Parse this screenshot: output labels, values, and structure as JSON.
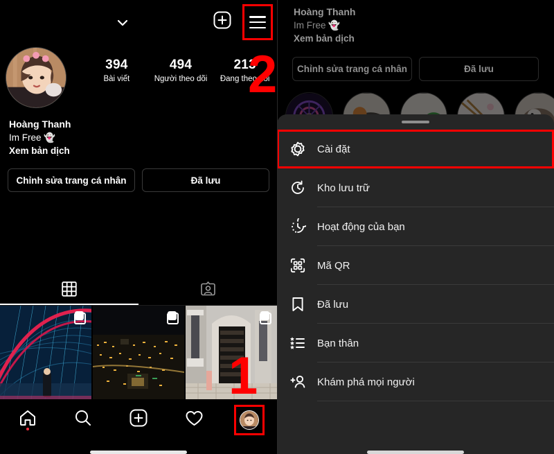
{
  "annotations": [
    {
      "id": "1",
      "target": "profile-tab-bottom-nav"
    },
    {
      "id": "2",
      "target": "hamburger-menu-button"
    },
    {
      "id": "3",
      "target": "settings-menu-item"
    }
  ],
  "colors": {
    "annotation_red": "#ff0000",
    "sheet_background": "#262626",
    "app_background": "#000000",
    "text_primary": "#ffffff",
    "notification_dot": "#ff3040"
  },
  "left_panel": {
    "topbar": {
      "chevron_icon": "chevron-down-icon",
      "add_icon": "plus-square-icon",
      "menu_icon": "hamburger-menu-icon"
    },
    "profile": {
      "avatar": "profile-avatar",
      "name": "Hoàng Thanh",
      "bio_line1": "Im Free 👻",
      "bio_line2": "Xem bản dịch"
    },
    "stats": [
      {
        "value": "394",
        "label": "Bài viết"
      },
      {
        "value": "494",
        "label": "Người theo dõi"
      },
      {
        "value": "213",
        "label": "Đang theo dõi"
      }
    ],
    "actions": [
      {
        "label": "Chỉnh sửa trang cá nhân"
      },
      {
        "label": "Đã lưu"
      }
    ],
    "tabs": [
      {
        "name": "grid-tab",
        "icon": "grid-icon",
        "active": true
      },
      {
        "name": "tagged-tab",
        "icon": "tagged-person-icon",
        "active": false
      }
    ],
    "grid_posts": [
      {
        "name": "post-ferris-wheel-lights",
        "is_carousel": true
      },
      {
        "name": "post-night-cityscape",
        "is_carousel": true
      },
      {
        "name": "post-building-entrance",
        "is_carousel": true
      }
    ],
    "bottom_nav": [
      {
        "name": "home-icon",
        "has_dot": true
      },
      {
        "name": "search-icon",
        "has_dot": false
      },
      {
        "name": "create-icon",
        "has_dot": false
      },
      {
        "name": "activity-heart-icon",
        "has_dot": false
      },
      {
        "name": "profile-avatar-icon",
        "has_dot": false,
        "highlighted": true
      }
    ]
  },
  "right_panel": {
    "profile": {
      "name": "Hoàng Thanh",
      "bio_line1": "Im Free 👻",
      "bio_line2": "Xem bản dịch"
    },
    "actions": [
      {
        "label": "Chỉnh sửa trang cá nhân"
      },
      {
        "label": "Đã lưu"
      }
    ],
    "highlights_count": 5,
    "sheet": {
      "grabber": "drag-handle",
      "items": [
        {
          "icon": "settings-gear-icon",
          "label": "Cài đặt",
          "highlighted": true
        },
        {
          "icon": "archive-clock-icon",
          "label": "Kho lưu trữ",
          "highlighted": false
        },
        {
          "icon": "activity-clock-icon",
          "label": "Hoạt động của bạn",
          "highlighted": false
        },
        {
          "icon": "qr-code-icon",
          "label": "Mã QR",
          "highlighted": false
        },
        {
          "icon": "bookmark-icon",
          "label": "Đã lưu",
          "highlighted": false
        },
        {
          "icon": "close-friends-list-icon",
          "label": "Bạn thân",
          "highlighted": false
        },
        {
          "icon": "discover-people-icon",
          "label": "Khám phá mọi người",
          "highlighted": false
        }
      ]
    }
  }
}
